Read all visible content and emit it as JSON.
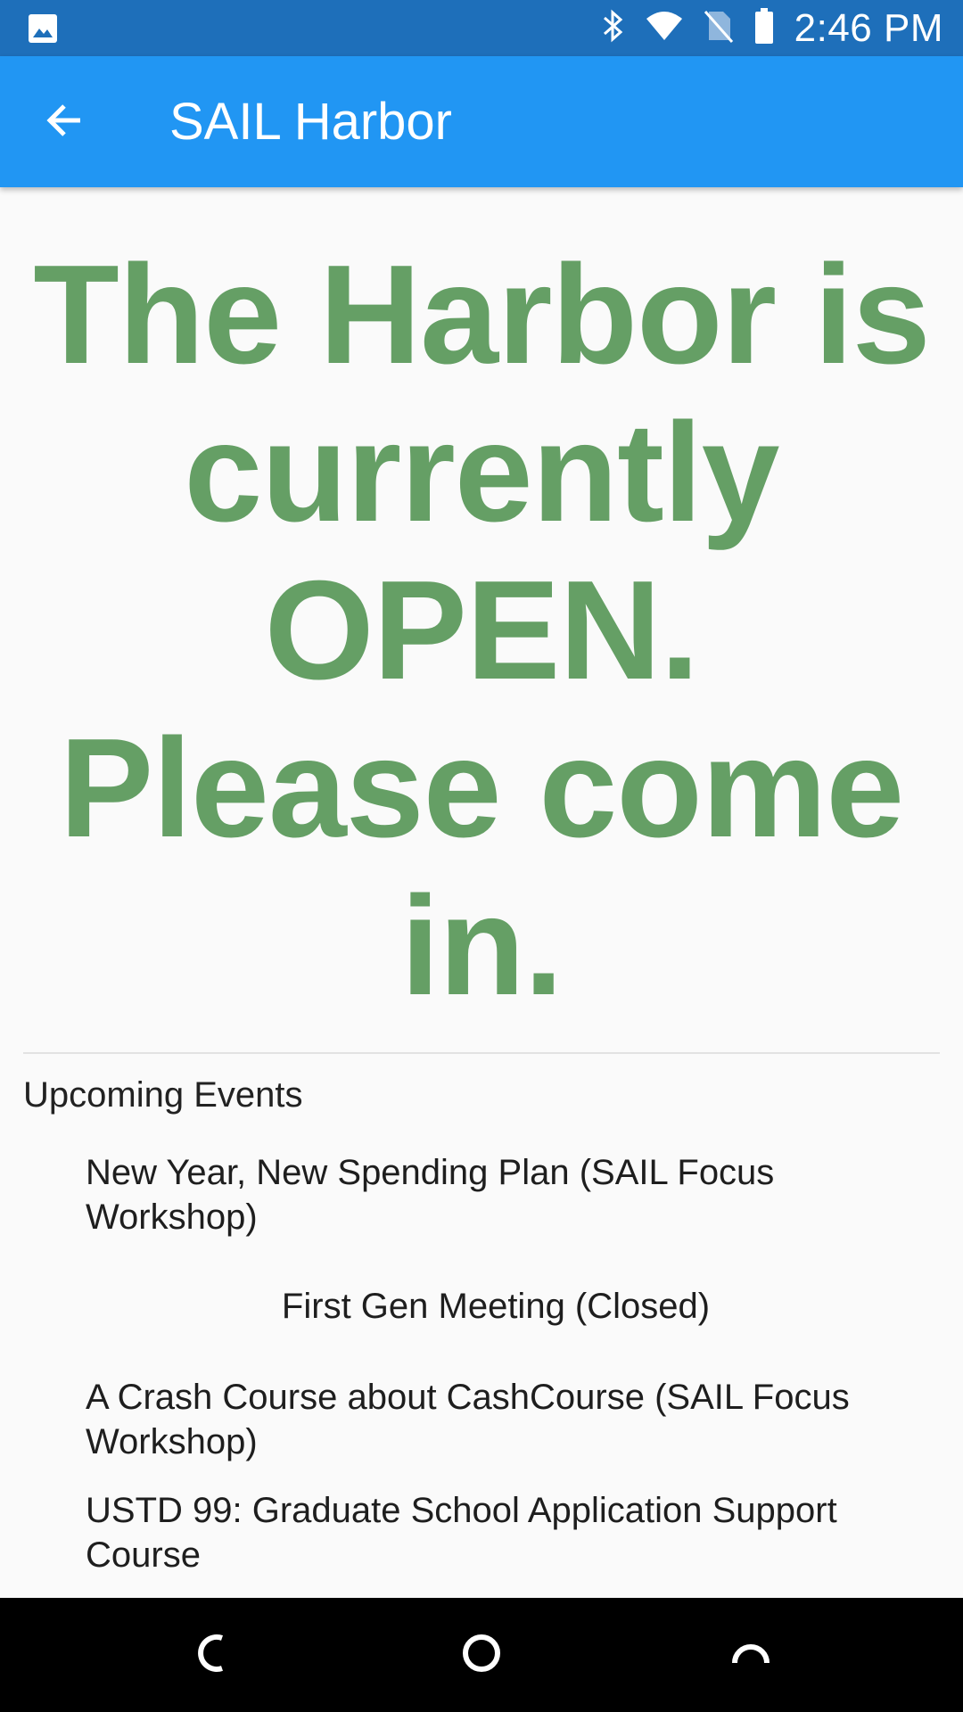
{
  "status_bar": {
    "time": "2:46 PM",
    "icons": [
      "image-icon",
      "bluetooth-icon",
      "wifi-icon",
      "no-sim-icon",
      "battery-icon"
    ]
  },
  "app_bar": {
    "title": "SAIL Harbor",
    "back_icon": "arrow-back-icon"
  },
  "main": {
    "status_message": "The Harbor is currently OPEN. Please come in.",
    "status_color": "#659f65"
  },
  "events": {
    "section_title": "Upcoming Events",
    "items": [
      {
        "label": "New Year, New Spending Plan (SAIL Focus Workshop)"
      },
      {
        "label": "First Gen Meeting (Closed)"
      },
      {
        "label": "A Crash Course about CashCourse (SAIL Focus Workshop)"
      },
      {
        "label": "USTD 99: Graduate School Application Support Course"
      }
    ]
  },
  "nav_bar": {
    "buttons": [
      "back-nav-icon",
      "home-nav-icon",
      "recents-nav-icon"
    ]
  },
  "colors": {
    "status_bar": "#1e6fba",
    "app_bar": "#2196f3",
    "background": "#fafafa"
  }
}
